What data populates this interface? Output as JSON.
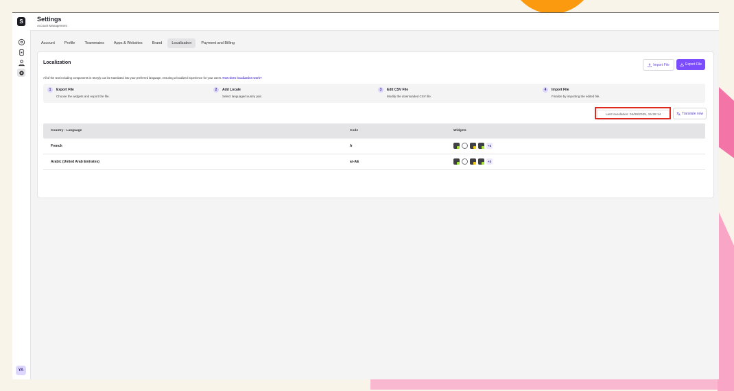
{
  "app": {
    "logo_text": "S",
    "avatar_initials": "YA"
  },
  "header": {
    "title": "Settings",
    "subtitle": "Account Management"
  },
  "tabs": [
    {
      "label": "Account"
    },
    {
      "label": "Profile"
    },
    {
      "label": "Teammates"
    },
    {
      "label": "Apps & Websites"
    },
    {
      "label": "Brand"
    },
    {
      "label": "Localization",
      "active": true
    },
    {
      "label": "Payment and Billing"
    }
  ],
  "card": {
    "title": "Localization",
    "import_label": "Import File",
    "export_label": "Export File",
    "description": "All of the text including components in Storyly can be translated into your preferred language, ensuring a localized experience for your users.",
    "description_link": "How does localization work?"
  },
  "steps": [
    {
      "num": "1",
      "title": "Export File",
      "desc": "Choose the widgets and export the file."
    },
    {
      "num": "2",
      "title": "Add Locale",
      "desc": "Select language/country pair."
    },
    {
      "num": "3",
      "title": "Edit CSV File",
      "desc": "Modify the downloaded CSV file."
    },
    {
      "num": "4",
      "title": "Import File",
      "desc": "Finalize by importing the edited file."
    }
  ],
  "last_translation": "Last translation: 04/08/2025, 15:28:14",
  "translate_now": "Translate now",
  "table": {
    "headers": [
      "Country - Language",
      "Code",
      "Widgets"
    ],
    "rows": [
      {
        "name": "French",
        "code": "fr",
        "more": "+3"
      },
      {
        "name": "Arabic (United Arab Emirates)",
        "code": "ar-AE",
        "more": "+3"
      }
    ]
  },
  "colors": {
    "accent": "#7c4dff",
    "highlight": "#e02a1f"
  }
}
